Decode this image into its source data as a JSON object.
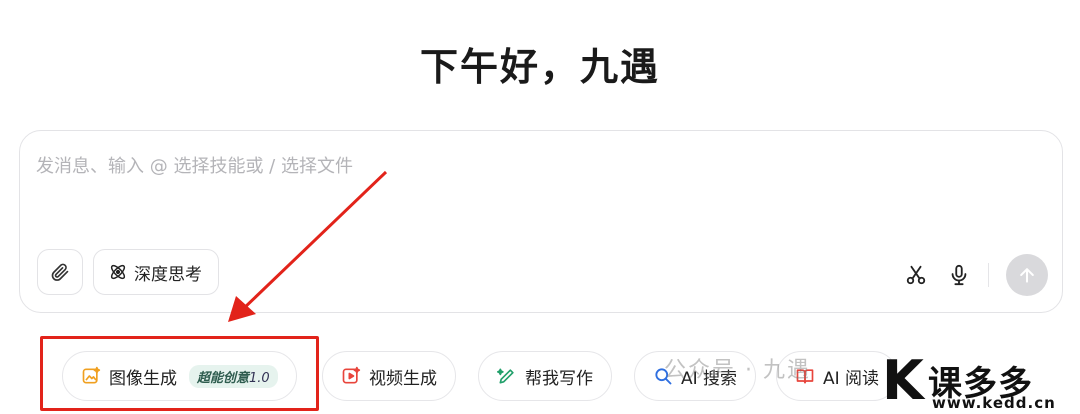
{
  "greeting": "下午好，九遇",
  "composer": {
    "placeholder": "发消息、输入 @ 选择技能或 / 选择文件",
    "deep_think_label": "深度思考"
  },
  "chips": [
    {
      "label": "图像生成",
      "badge": "超能创意",
      "badge_version": "1.0"
    },
    {
      "label": "视频生成"
    },
    {
      "label": "帮我写作"
    },
    {
      "label": "AI 搜索"
    },
    {
      "label": "AI 阅读"
    }
  ],
  "watermark": "公众号 · 九遇",
  "logo": {
    "mark": "K",
    "text": "课多多",
    "url": "www.kedd.cn"
  },
  "colors": {
    "highlight": "#e2231a",
    "accent_orange": "#f0a020",
    "accent_red": "#e8453c",
    "accent_green": "#22a06b",
    "accent_blue": "#2f6fe0"
  }
}
